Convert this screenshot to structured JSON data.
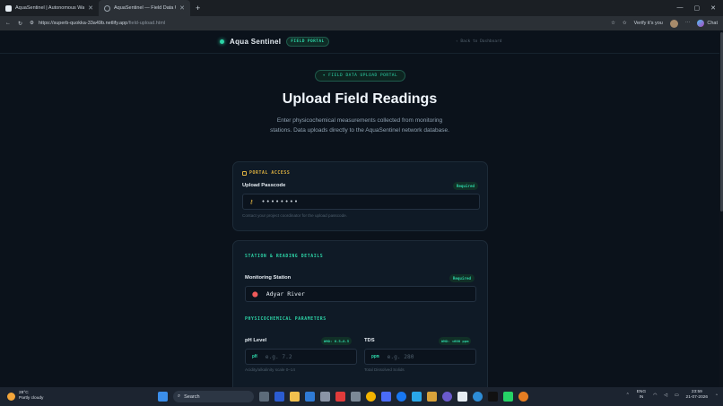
{
  "browser": {
    "tabs": [
      {
        "title": "AquaSentinel | Autonomous Wate",
        "active": false
      },
      {
        "title": "AquaSentinel — Field Data Uploa",
        "active": true
      }
    ],
    "url_host": "https://superb-quokka-33a49b.netlify.app",
    "url_path": "/field-upload.html",
    "profile_label": "Verify it's you",
    "chat_label": "Chat"
  },
  "nav": {
    "brand_first": "Aqua",
    "brand_second": "Sentinel",
    "badge": "FIELD PORTAL",
    "back_link": "‹ Back to Dashboard"
  },
  "hero": {
    "pill": "✦ FIELD DATA UPLOAD PORTAL",
    "title": "Upload Field Readings",
    "subtitle": "Enter physicochemical measurements collected from monitoring stations. Data uploads directly to the AquaSentinel network database."
  },
  "access": {
    "heading": "PORTAL ACCESS",
    "passcode_label": "Upload Passcode",
    "required": "Required",
    "passcode_value": "••••••••",
    "hint": "Contact your project coordinator for the upload passcode."
  },
  "station": {
    "heading": "STATION & READING DETAILS",
    "label": "Monitoring Station",
    "required": "Required",
    "value": "Adyar River"
  },
  "params": {
    "heading": "PHYSICOCHEMICAL PARAMETERS",
    "ph": {
      "label": "pH Level",
      "badge": "WHO: 6.5–8.5",
      "unit": "pH",
      "placeholder": "e.g. 7.2",
      "hint": "Acidity/alkalinity scale 0–14"
    },
    "tds": {
      "label": "TDS",
      "badge": "WHO: <600 ppm",
      "unit": "ppm",
      "placeholder": "e.g. 280",
      "hint": "Total Dissolved Solids"
    }
  },
  "taskbar": {
    "temp": "28°C",
    "condition": "Partly cloudy",
    "search": "Search",
    "lang1": "ENG",
    "lang2": "IN",
    "time": "23:59",
    "date": "21-07-2026"
  },
  "colors": {
    "accent": "#2dd4a7",
    "warning": "#e0b341",
    "background": "#0b121b"
  }
}
